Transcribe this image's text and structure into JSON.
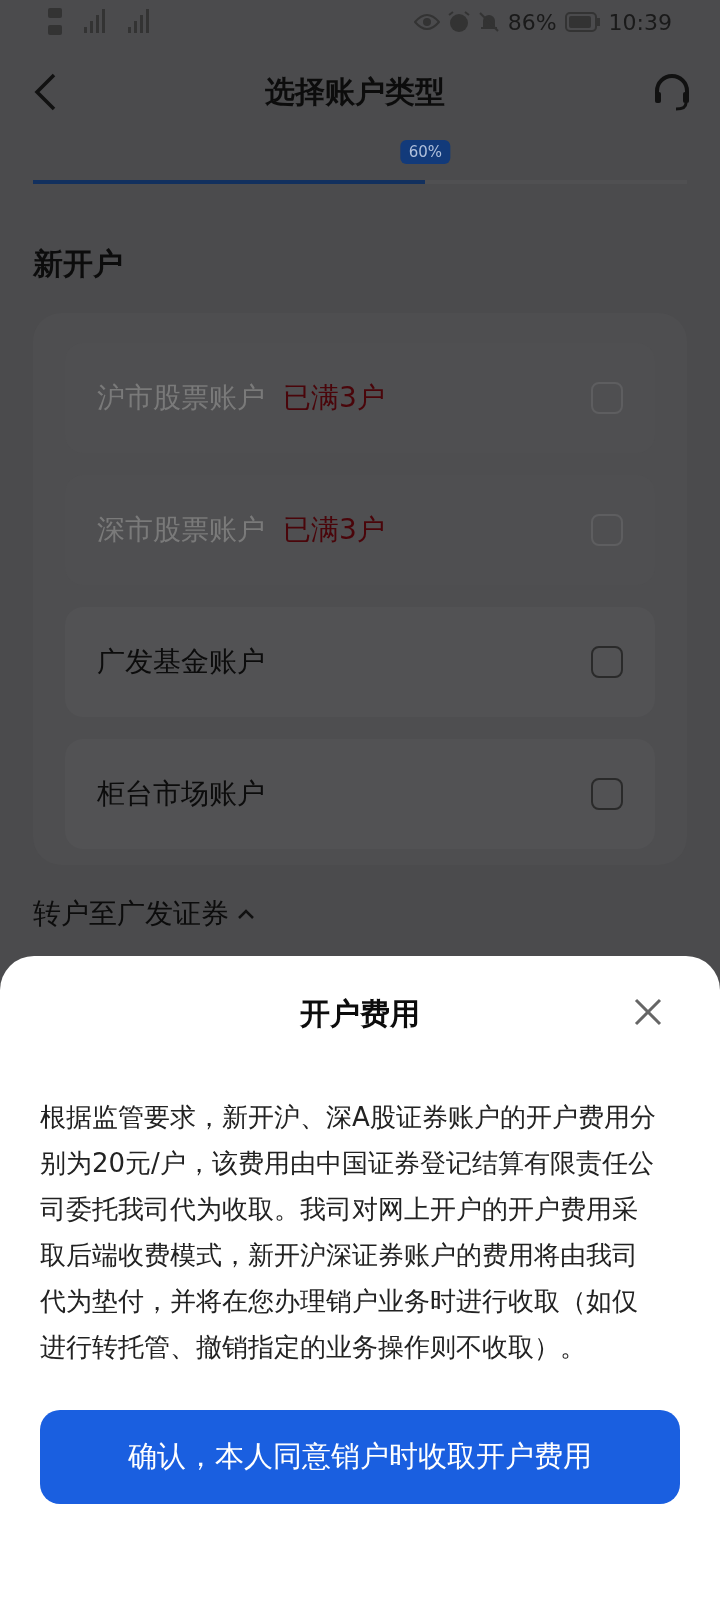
{
  "status_bar": {
    "battery": "86%",
    "time": "10:39"
  },
  "header": {
    "title": "选择账户类型"
  },
  "progress": {
    "level": 0.6,
    "label": "60%"
  },
  "section": {
    "title": "新开户"
  },
  "accounts": [
    {
      "name": "沪市股票账户",
      "tag": "已满3户",
      "disabled": true,
      "checked": false
    },
    {
      "name": "深市股票账户",
      "tag": "已满3户",
      "disabled": true,
      "checked": false
    },
    {
      "name": "广发基金账户",
      "disabled": false,
      "checked": false
    },
    {
      "name": "柜台市场账户",
      "disabled": false,
      "checked": false
    }
  ],
  "transfer_section": {
    "title": "转户至广发证券",
    "expanded": true
  },
  "sheet": {
    "title": "开户费用",
    "body": "根据监管要求，新开沪、深A股证券账户的开户费用分别为20元/户，该费用由中国证券登记结算有限责任公司委托我司代为收取。我司对网上开户的开户费用采取后端收费模式，新开沪深证券账户的费用将由我司代为垫付，并将在您办理销户业务时进行收取（如仅进行转托管、撤销指定的业务操作则不收取）。",
    "button": "确认，本人同意销户时收取开户费用"
  }
}
